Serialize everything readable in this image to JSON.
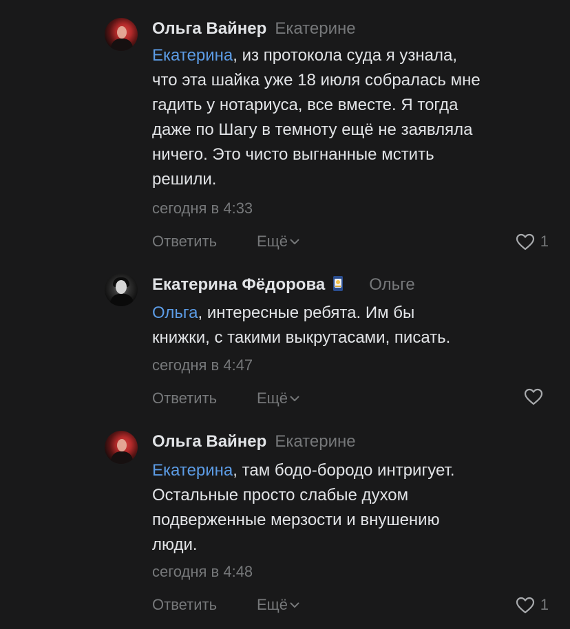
{
  "comments": [
    {
      "author": "Ольга Вайнер",
      "reply_to": "Екатерине",
      "mention": "Екатерина",
      "text_lines": [
        ", из протокола суда я узнала,",
        "что эта шайка уже 18 июля собралась мне",
        "гадить у нотариуса, все вместе. Я тогда",
        "даже по Шагу в темноту ещё не заявляла",
        "ничего. Это чисто выгнанные мстить",
        "решили."
      ],
      "date": "сегодня в 4:33",
      "reply_label": "Ответить",
      "more_label": "Ещё",
      "likes": "1",
      "avatar_icon": "user-avatar-photo"
    },
    {
      "author": "Екатерина Фёдорова",
      "reply_to": "Ольге",
      "mention": "Ольга",
      "text_lines": [
        ", интересные ребята. Им бы",
        "книжки, с такими выкрутасами, писать."
      ],
      "date": "сегодня в 4:47",
      "reply_label": "Ответить",
      "more_label": "Ещё",
      "likes": "",
      "avatar_icon": "user-avatar-photo",
      "badge_icon": "cup-sticker-icon"
    },
    {
      "author": "Ольга Вайнер",
      "reply_to": "Екатерине",
      "mention": "Екатерина",
      "text_lines": [
        ", там бодо-бородо интригует.",
        "Остальные просто слабые духом",
        "подверженные мерзости и внушению",
        "люди."
      ],
      "date": "сегодня в 4:48",
      "reply_label": "Ответить",
      "more_label": "Ещё",
      "likes": "1",
      "avatar_icon": "user-avatar-photo"
    }
  ],
  "colors": {
    "background": "#19191a",
    "text": "#e1e3e6",
    "secondary": "#76787a",
    "link": "#5c9ce6"
  }
}
